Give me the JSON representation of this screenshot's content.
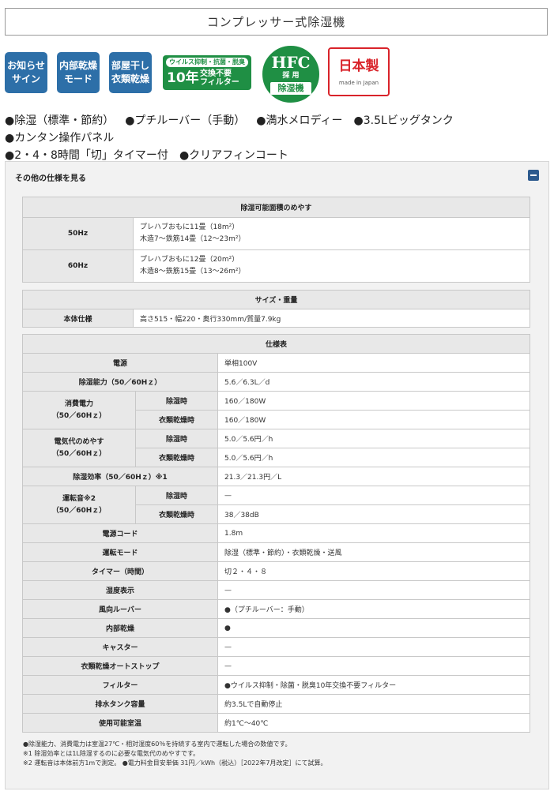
{
  "title": "コンプレッサー式除湿機",
  "badges": {
    "notify": [
      "お知らせ",
      "サイン"
    ],
    "internal_dry": [
      "内部乾燥",
      "モード"
    ],
    "indoor_dry": [
      "部屋干し",
      "衣類乾燥"
    ],
    "filter": {
      "top": "ウイルス抑制・抗菌・脱臭",
      "years": "10年",
      "line1": "交換不要",
      "line2": "フィルター"
    },
    "hfc": {
      "main": "HFC",
      "sub": "採 用",
      "bottom": "除湿機"
    },
    "japan": {
      "main": "日本製",
      "sub": "made in Japan"
    }
  },
  "features": [
    "●除湿（標準・節約）",
    "●プチルーバー（手動）",
    "●満水メロディー",
    "●3.5Lビッグタンク",
    "●カンタン操作パネル",
    "●2・4・8時間「切」タイマー付",
    "●クリアフィンコート"
  ],
  "specs_toggle_label": "その他の仕様を見る",
  "area_table": {
    "header": "除湿可能面積のめやす",
    "rows": [
      {
        "label": "50Hz",
        "line1": "プレハブおもに11畳（18m²）",
        "line2": "木造7～鉄筋14畳（12～23m²）"
      },
      {
        "label": "60Hz",
        "line1": "プレハブおもに12畳（20m²）",
        "line2": "木造8～鉄筋15畳（13～26m²）"
      }
    ]
  },
  "size_table": {
    "header": "サイズ・重量",
    "label": "本体仕様",
    "value": "高さ515・幅220・奥行330mm/質量7.9kg"
  },
  "spec_table": {
    "header": "仕様表",
    "power_source": {
      "label": "電源",
      "value": "単相100V"
    },
    "dehumid_capacity": {
      "label": "除湿能力（50／60Hｚ）",
      "value": "5.6／6.3L／d"
    },
    "power_consumption": {
      "label_line1": "消費電力",
      "label_line2": "（50／60Hｚ）",
      "sub1": {
        "label": "除湿時",
        "value": "160／180W"
      },
      "sub2": {
        "label": "衣類乾燥時",
        "value": "160／180W"
      }
    },
    "electricity_cost": {
      "label_line1": "電気代のめやす",
      "label_line2": "（50／60Hｚ）",
      "sub1": {
        "label": "除湿時",
        "value": "5.0／5.6円／h"
      },
      "sub2": {
        "label": "衣類乾燥時",
        "value": "5.0／5.6円／h"
      }
    },
    "dehumid_efficiency": {
      "label": "除湿効率（50／60Hｚ）※1",
      "value": "21.3／21.3円／L"
    },
    "noise": {
      "label_line1": "運転音※2",
      "label_line2": "（50／60Hｚ）",
      "sub1": {
        "label": "除湿時",
        "value": "—"
      },
      "sub2": {
        "label": "衣類乾燥時",
        "value": "38／38dB"
      }
    },
    "power_cord": {
      "label": "電源コード",
      "value": "1.8m"
    },
    "operation_mode": {
      "label": "運転モード",
      "value": "除湿（標準・節約）・衣類乾燥・送風"
    },
    "timer": {
      "label": "タイマー（時間）",
      "value": "切２・４・８"
    },
    "humidity_display": {
      "label": "湿度表示",
      "value": "—"
    },
    "louver": {
      "label": "風向ルーバー",
      "value": "●（プチルーバー：手動）"
    },
    "internal_dry": {
      "label": "内部乾燥",
      "value": "●"
    },
    "caster": {
      "label": "キャスター",
      "value": "—"
    },
    "auto_stop": {
      "label": "衣類乾燥オートストップ",
      "value": "—"
    },
    "filter": {
      "label": "フィルター",
      "value": "●ウイルス抑制・除菌・脱臭10年交換不要フィルター"
    },
    "tank": {
      "label": "排水タンク容量",
      "value": "約3.5Lで自動停止"
    },
    "operating_temp": {
      "label": "使用可能室温",
      "value": "約1℃～40℃"
    }
  },
  "notes": [
    "●除湿能力、消費電力は室温27℃・相対湿度60％を持続する室内で運転した場合の数値です。",
    "※1 除湿効率とは1L除湿するのに必要な電気代のめやすです。",
    "※2 運転音は本体前方1mで測定。 ●電力料金目安単価 31円／kWh（税込）［2022年7月改定］にて試算。"
  ]
}
